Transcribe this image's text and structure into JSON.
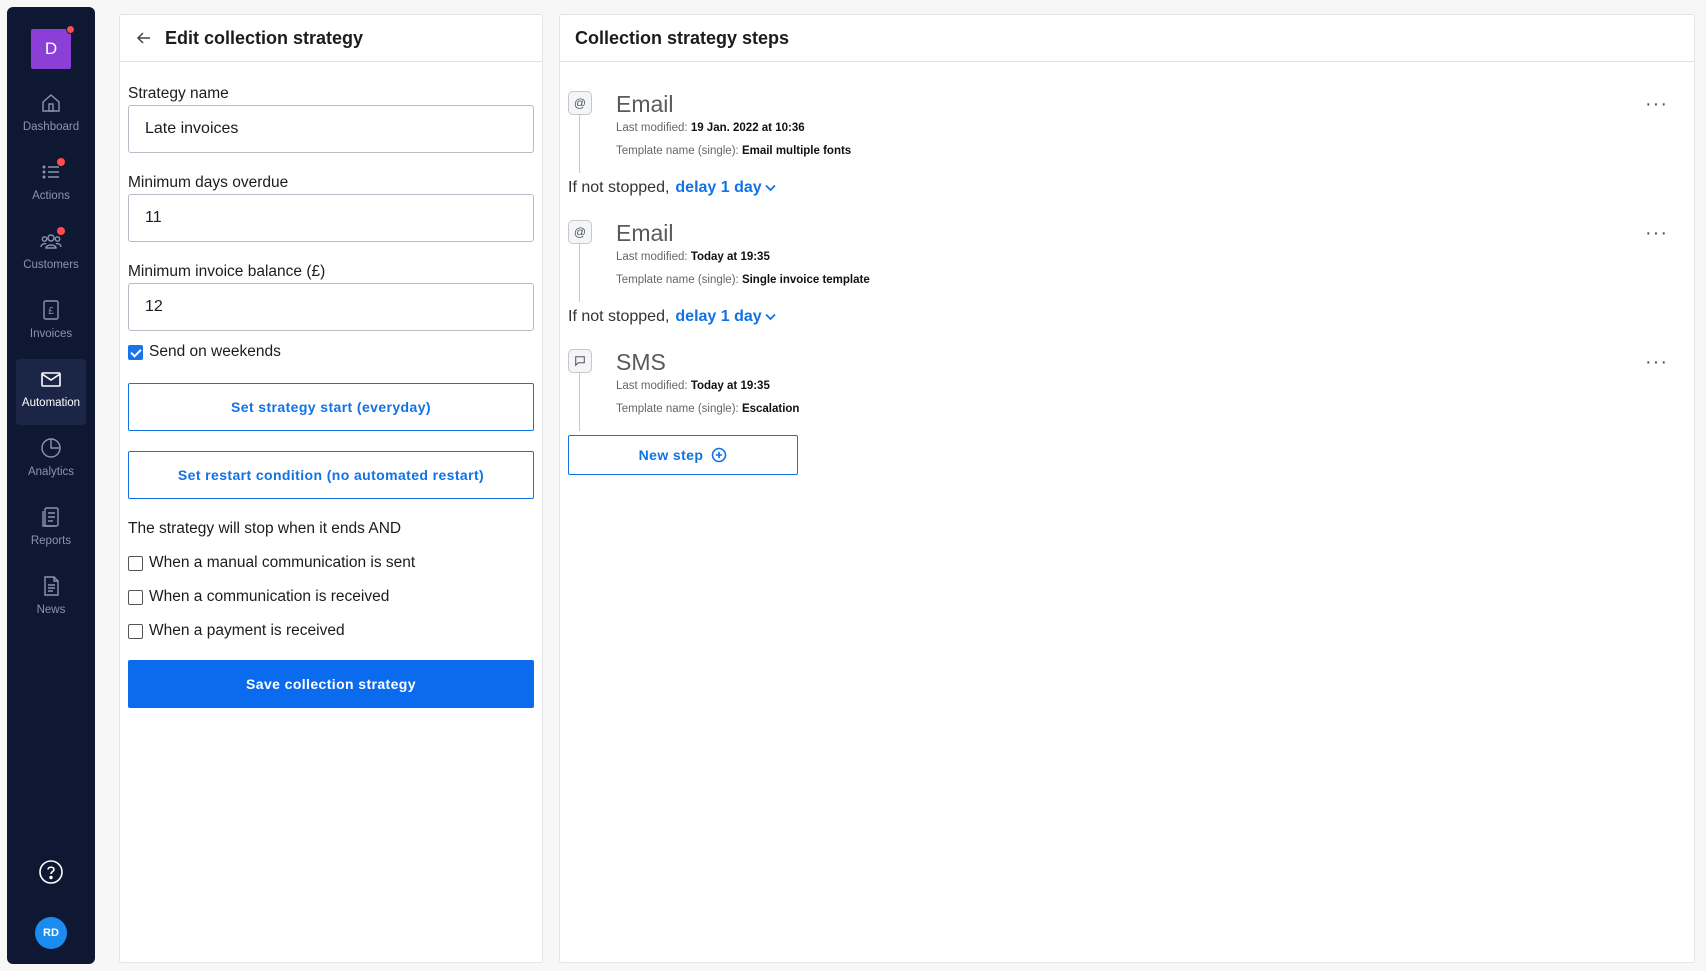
{
  "sidebar": {
    "org_initial": "D",
    "items": [
      {
        "label": "Dashboard",
        "icon": "home-icon",
        "badge": false,
        "active": false
      },
      {
        "label": "Actions",
        "icon": "list-icon",
        "badge": true,
        "active": false
      },
      {
        "label": "Customers",
        "icon": "users-icon",
        "badge": true,
        "active": false
      },
      {
        "label": "Invoices",
        "icon": "invoice-pound-icon",
        "badge": false,
        "active": false
      },
      {
        "label": "Automation",
        "icon": "mail-icon",
        "badge": false,
        "active": true
      },
      {
        "label": "Analytics",
        "icon": "pie-chart-icon",
        "badge": false,
        "active": false
      },
      {
        "label": "Reports",
        "icon": "report-icon",
        "badge": false,
        "active": false
      },
      {
        "label": "News",
        "icon": "news-icon",
        "badge": false,
        "active": false
      }
    ],
    "user_initials": "RD"
  },
  "edit_panel": {
    "title": "Edit collection strategy",
    "strategy_name_label": "Strategy name",
    "strategy_name_value": "Late invoices",
    "min_days_label": "Minimum days overdue",
    "min_days_value": "11",
    "min_balance_label": "Minimum invoice balance (£)",
    "min_balance_value": "12",
    "weekends_label": "Send on weekends",
    "weekends_checked": true,
    "strategy_start_button": "Set strategy start (everyday)",
    "restart_condition_button": "Set restart condition (no automated restart)",
    "stop_text": "The strategy will stop when it ends AND",
    "stop_conditions": [
      {
        "label": "When a manual communication is sent",
        "checked": false
      },
      {
        "label": "When a communication is received",
        "checked": false
      },
      {
        "label": "When a payment is received",
        "checked": false
      }
    ],
    "save_button": "Save collection strategy"
  },
  "steps_panel": {
    "title": "Collection strategy steps",
    "steps": [
      {
        "type": "Email",
        "icon": "at-sign-icon",
        "last_modified_label": "Last modified:",
        "last_modified": "19 Jan. 2022 at 10:36",
        "template_label": "Template name (single):",
        "template": "Email multiple fonts"
      },
      {
        "type": "Email",
        "icon": "at-sign-icon",
        "last_modified_label": "Last modified:",
        "last_modified": "Today at 19:35",
        "template_label": "Template name (single):",
        "template": "Single invoice template"
      },
      {
        "type": "SMS",
        "icon": "chat-bubble-icon",
        "last_modified_label": "Last modified:",
        "last_modified": "Today at 19:35",
        "template_label": "Template name (single):",
        "template": "Escalation"
      }
    ],
    "delays": [
      {
        "prefix": "If not stopped,",
        "link": "delay 1 day"
      },
      {
        "prefix": "If not stopped,",
        "link": "delay 1 day"
      }
    ],
    "new_step_button": "New step",
    "menu_glyph": "···"
  },
  "colors": {
    "sidebar_bg": "#0f1833",
    "accent": "#0b6bef",
    "org_logo": "#8b3fd6",
    "badge": "#ff4b4b",
    "avatar": "#1a8cf0"
  }
}
